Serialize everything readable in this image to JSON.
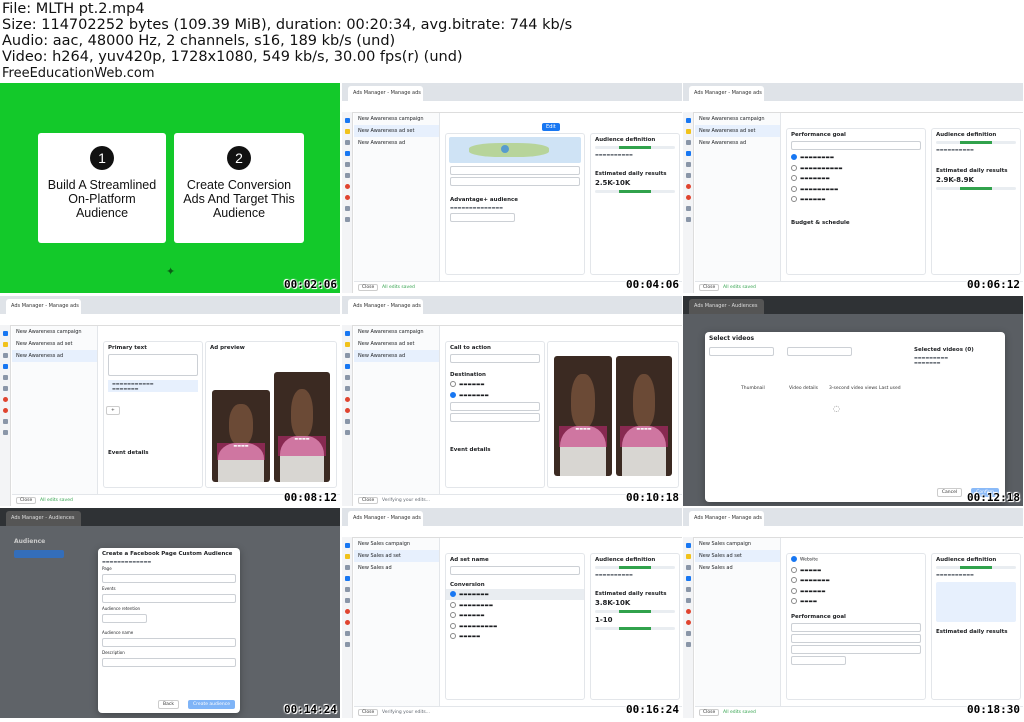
{
  "header": {
    "file": "File: MLTH pt.2.mp4",
    "size": "Size: 114702252 bytes (109.39 MiB), duration: 00:20:34, avg.bitrate: 744 kb/s",
    "audio": "Audio: aac, 48000 Hz, 2 channels, s16, 189 kb/s (und)",
    "video": "Video: h264, yuv420p, 1728x1080, 549 kb/s, 30.00 fps(r) (und)",
    "brand": "FreeEducationWeb.com"
  },
  "thumbs": [
    {
      "timestamp": "00:02:06",
      "num1": "1",
      "num2": "2",
      "card1": "Build A Streamlined On-Platform Audience",
      "card2": "Create Conversion Ads And Target This Audience"
    },
    {
      "timestamp": "00:04:06",
      "tab": "Ads Manager - Manage ads",
      "camp1": "New Awareness campaign",
      "camp2": "New Awareness ad set",
      "camp3": "New Awareness ad",
      "sect1": "Advantage+ audience",
      "sect2": "Audience definition",
      "sect3": "Estimated daily results",
      "reach": "2.5K-10K",
      "close": "Close",
      "saved": "All edits saved"
    },
    {
      "timestamp": "00:06:12",
      "tab": "Ads Manager - Manage ads",
      "camp1": "New Awareness campaign",
      "camp2": "New Awareness ad set",
      "camp3": "New Awareness ad",
      "sect1": "Performance goal",
      "sect2": "Audience definition",
      "sect3": "Estimated daily results",
      "reach": "2.9K-8.9K",
      "sect4": "Budget & schedule",
      "close": "Close",
      "saved": "All edits saved"
    },
    {
      "timestamp": "00:08:12",
      "tab": "Ads Manager - Manage ads",
      "camp1": "New Awareness campaign",
      "camp2": "New Awareness ad set",
      "camp3": "New Awareness ad",
      "sect1": "Primary text",
      "sect2": "Ad preview",
      "sect3": "Event details",
      "close": "Close",
      "saved": "All edits saved"
    },
    {
      "timestamp": "00:10:18",
      "tab": "Ads Manager - Manage ads",
      "camp1": "New Awareness campaign",
      "camp2": "New Awareness ad set",
      "camp3": "New Awareness ad",
      "sect1": "Call to action",
      "sect2": "Destination",
      "sect3": "Event details",
      "close": "Close",
      "saved": "Verifying your edits..."
    },
    {
      "timestamp": "00:12:18",
      "tab": "Ads Manager - Audiences",
      "modal_title": "Select videos",
      "col1": "Thumbnail",
      "col2": "Video details",
      "col3": "3-second video views",
      "col4": "Last used",
      "side_title": "Selected videos (0)",
      "cancel": "Cancel",
      "confirm": "Confirm"
    },
    {
      "timestamp": "00:14:24",
      "tab": "Ads Manager - Audiences",
      "page_title": "Audience",
      "modal_title": "Create a Facebook Page Custom Audience",
      "f1": "Page",
      "f2": "Events",
      "f3": "Audience retention",
      "f4": "Audience name",
      "f5": "Description",
      "back": "Back",
      "create": "Create audience"
    },
    {
      "timestamp": "00:16:24",
      "tab": "Ads Manager - Manage ads",
      "camp1": "New Sales campaign",
      "camp2": "New Sales ad set",
      "camp3": "New Sales ad",
      "sect1": "Ad set name",
      "sect2": "Conversion",
      "sect3": "Audience definition",
      "sect4": "Estimated daily results",
      "reach": "3.8K-10K",
      "conv": "1-10",
      "close": "Close",
      "saved": "Verifying your edits..."
    },
    {
      "timestamp": "00:18:30",
      "tab": "Ads Manager - Manage ads",
      "camp1": "New Sales campaign",
      "camp2": "New Sales ad set",
      "camp3": "New Sales ad",
      "sect1": "Website",
      "sect2": "Performance goal",
      "sect3": "Audience definition",
      "sect4": "Estimated daily results",
      "close": "Close",
      "saved": "All edits saved"
    }
  ]
}
